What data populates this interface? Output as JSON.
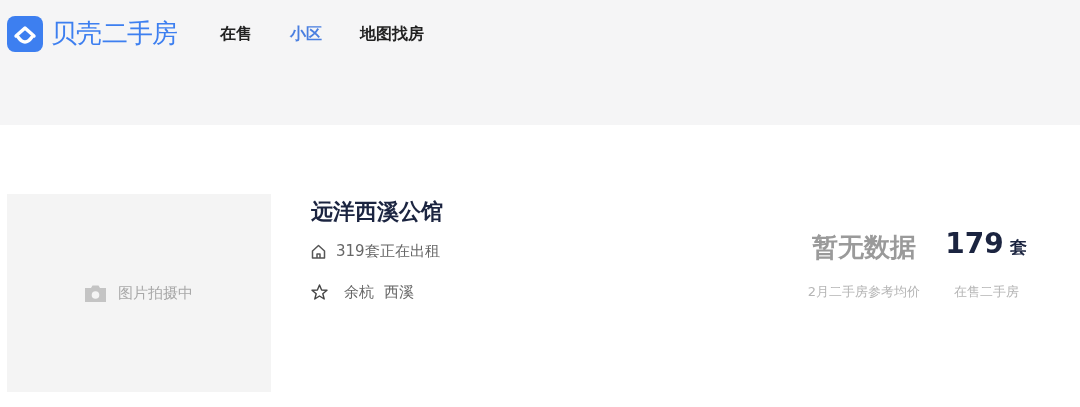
{
  "header": {
    "logo": "贝壳二手房",
    "nav": [
      {
        "label": "在售",
        "selected": false
      },
      {
        "label": "小区",
        "selected": true
      },
      {
        "label": "地图找房",
        "selected": false
      }
    ]
  },
  "listing": {
    "photo_placeholder": "图片拍摄中",
    "name": "远洋西溪公馆",
    "rental": "319套正在出租",
    "areas": [
      "余杭",
      "西溪"
    ],
    "stats": [
      {
        "kind": "empty",
        "value": "暂无数据",
        "label": "2月二手房参考均价"
      },
      {
        "kind": "count",
        "value": "179",
        "unit": "套",
        "label": "在售二手房"
      }
    ]
  }
}
